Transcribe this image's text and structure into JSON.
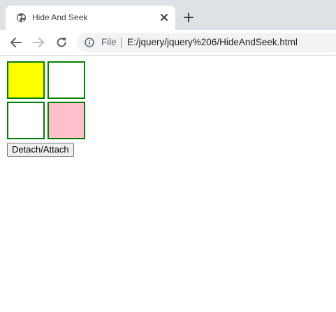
{
  "browser": {
    "tab": {
      "title": "Hide And Seek",
      "favicon_icon": "globe-icon",
      "close_icon": "close-icon"
    },
    "new_tab_icon": "plus-icon",
    "toolbar": {
      "back_icon": "arrow-left-icon",
      "forward_icon": "arrow-right-icon",
      "reload_icon": "reload-icon",
      "info_icon": "info-icon",
      "scheme_label": "File",
      "url": "E:/jquery/jquery%206/HideAndSeek.html"
    }
  },
  "page": {
    "boxes": [
      {
        "name": "box-1",
        "color": "#ffff00"
      },
      {
        "name": "box-2",
        "color": "#ffffff"
      },
      {
        "name": "box-3",
        "color": "#ffffff"
      },
      {
        "name": "box-4",
        "color": "#ffc0cb"
      }
    ],
    "border_color": "#008000",
    "button_label": "Detach/Attach"
  }
}
